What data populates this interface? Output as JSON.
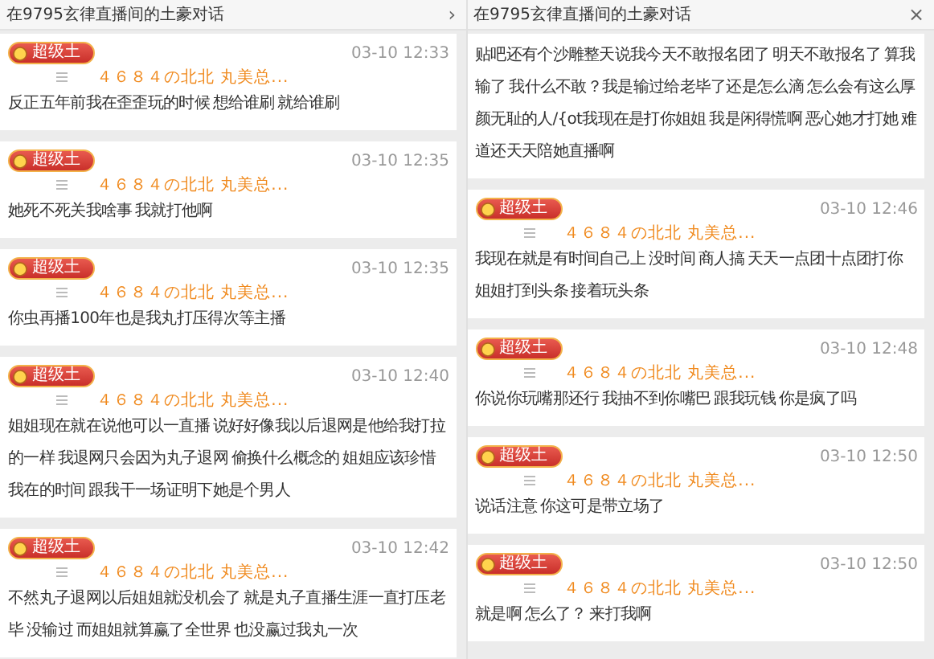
{
  "panels": [
    {
      "title": "在9795玄律直播间的土豪对话",
      "action": "›",
      "messages": [
        {
          "kind": "full",
          "badge": "超级土",
          "time": "03-10 12:33",
          "name": "４６８４の北北 丸美总...",
          "text": "反正五年前我在歪歪玩的时候 想给谁刷 就给谁刷"
        },
        {
          "kind": "full",
          "badge": "超级土",
          "time": "03-10 12:35",
          "name": "４６８４の北北 丸美总...",
          "text": "她死不死关我啥事 我就打他啊"
        },
        {
          "kind": "full",
          "badge": "超级土",
          "time": "03-10 12:35",
          "name": "４６８４の北北 丸美总...",
          "text": "你虫再播100年也是我丸打压得次等主播"
        },
        {
          "kind": "full",
          "badge": "超级土",
          "time": "03-10 12:40",
          "name": "４６８４の北北 丸美总...",
          "text": "姐姐现在就在说他可以一直播 说好好像我以后退网是他给我打拉的一样 我退网只会因为丸子退网 偷换什么概念的 姐姐应该珍惜我在的时间 跟我干一场证明下她是个男人"
        },
        {
          "kind": "full",
          "badge": "超级土",
          "time": "03-10 12:42",
          "name": "４６８４の北北 丸美总...",
          "text": "不然丸子退网以后姐姐就没机会了 就是丸子直播生涯一直打压老毕 没输过 而姐姐就算赢了全世界 也没赢过我丸一次"
        }
      ]
    },
    {
      "title": "在9795玄律直播间的土豪对话",
      "action": "×",
      "messages": [
        {
          "kind": "text_only",
          "text": "贴吧还有个沙雕整天说我今天不敢报名团了 明天不敢报名了 算我输了 我什么不敢？我是输过给老毕了还是怎么滴 怎么会有这么厚颜无耻的人/{ot我现在是打你姐姐 我是闲得慌啊 恶心她才打她 难道还天天陪她直播啊"
        },
        {
          "kind": "full",
          "badge": "超级土",
          "time": "03-10 12:46",
          "name": "４６８４の北北 丸美总...",
          "text": "我现在就是有时间自己上 没时间 商人搞 天天一点团十点团打你姐姐打到头条 接着玩头条"
        },
        {
          "kind": "full",
          "badge": "超级土",
          "time": "03-10 12:48",
          "name": "４６８４の北北 丸美总...",
          "text": "你说你玩嘴那还行 我抽不到你嘴巴 跟我玩钱 你是疯了吗"
        },
        {
          "kind": "full",
          "badge": "超级土",
          "time": "03-10 12:50",
          "name": "４６８４の北北 丸美总...",
          "text": "说话注意 你这可是带立场了"
        },
        {
          "kind": "full",
          "badge": "超级土",
          "time": "03-10 12:50",
          "name": "４６８４の北北 丸美总...",
          "text": "就是啊 怎么了？ 来打我啊"
        }
      ]
    }
  ]
}
